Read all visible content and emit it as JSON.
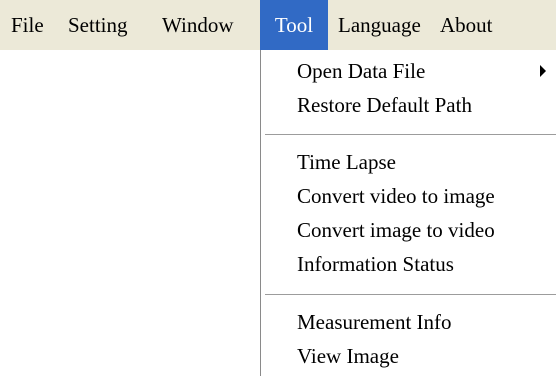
{
  "menubar": {
    "items": [
      {
        "label": "File"
      },
      {
        "label": "Setting"
      },
      {
        "label": "Window"
      },
      {
        "label": "Tool"
      },
      {
        "label": "Language"
      },
      {
        "label": "About"
      }
    ]
  },
  "tool_menu": {
    "open_data_file": "Open Data File",
    "restore_default_path": "Restore Default Path",
    "time_lapse": "Time Lapse",
    "convert_video_to_image": "Convert video to image",
    "convert_image_to_video": "Convert image to video",
    "information_status": "Information Status",
    "measurement_info": "Measurement Info",
    "view_image": "View Image"
  },
  "colors": {
    "menubar_background": "#ece9d8",
    "highlight": "#316ac5",
    "highlight_text": "#ffffff",
    "menu_background": "#ffffff"
  },
  "icons": {
    "submenu_arrow": "chevron-right-icon"
  }
}
